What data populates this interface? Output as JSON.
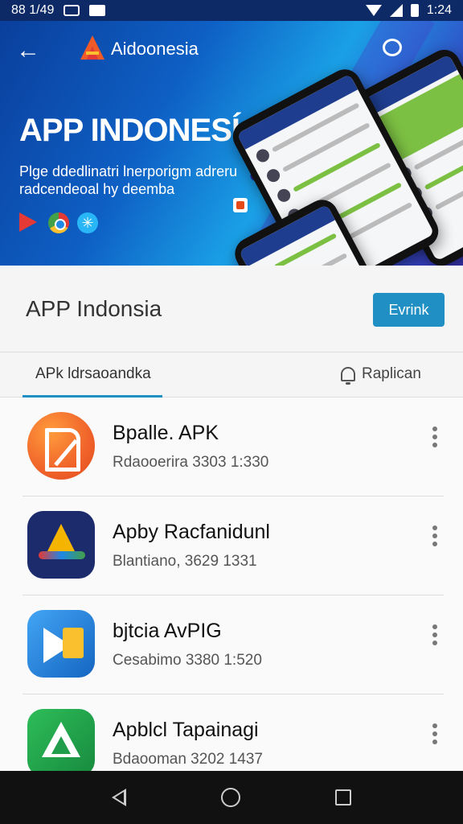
{
  "status_bar": {
    "time_left": "88 1/49",
    "time_right": "1:24"
  },
  "hero": {
    "brand": "Aidoonesia",
    "title": "APP INDONESÍA",
    "subtitle": "Plge ddedlinatri lnerporigm adreru radcendeoal hy deemba"
  },
  "app": {
    "name": "APP Indonsia",
    "button_label": "Evrink"
  },
  "tabs": {
    "left": "APk ldrsaoandka",
    "right": "Raplican"
  },
  "apps": [
    {
      "title": "Bpalle. APK",
      "meta": "Rdaooerira 3303 1:330"
    },
    {
      "title": "Apby Racfanidunl",
      "meta": "Blantiano, 3629 1331"
    },
    {
      "title": "bjtcia AvPIG",
      "meta": "Cesabimo 3380 1:520"
    },
    {
      "title": "Apblcl Tapainagi",
      "meta": "Bdaooman 3202 1437"
    }
  ],
  "colors": {
    "accent": "#1f8fc4",
    "hero": "#0e5fc4",
    "nav": "#111111"
  }
}
